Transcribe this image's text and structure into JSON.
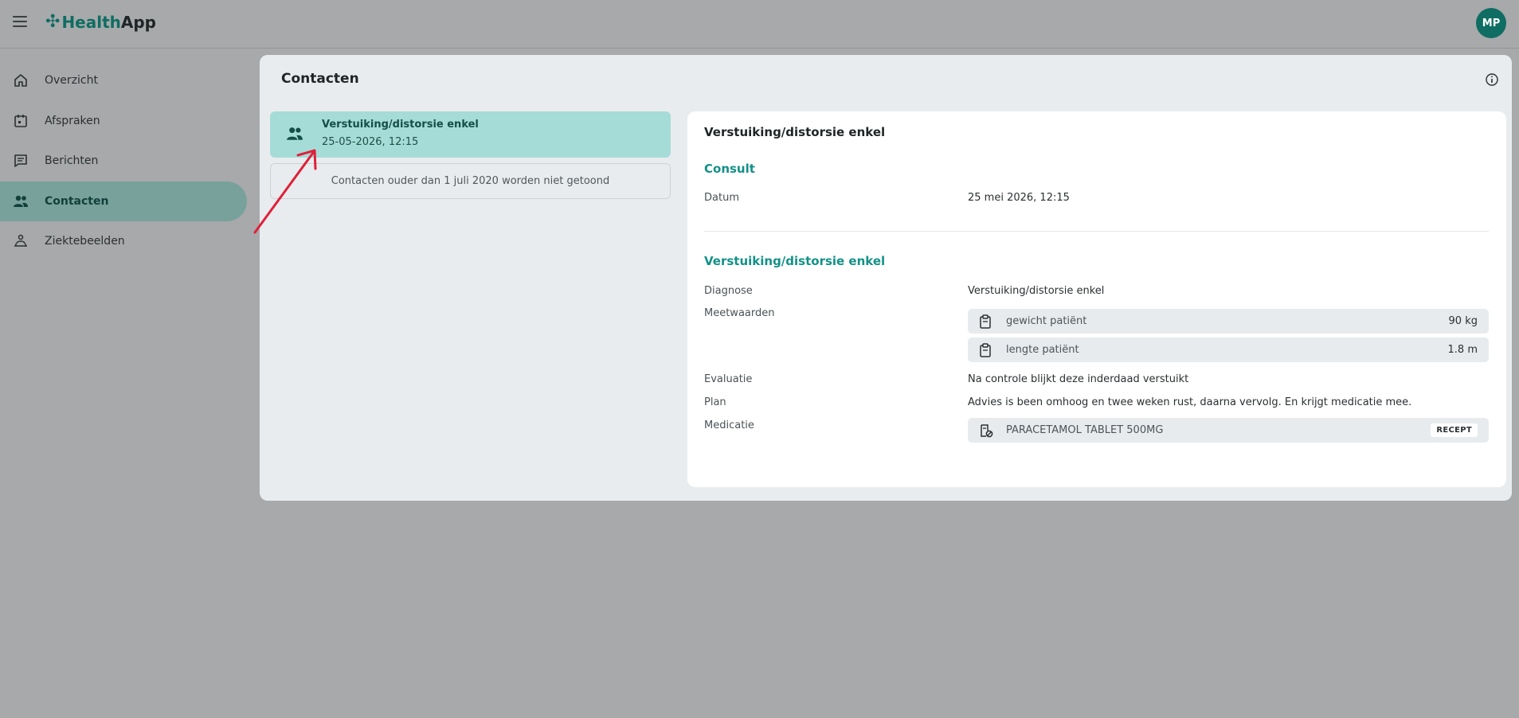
{
  "app": {
    "logo_part1": "Health",
    "logo_part2": "App",
    "user_initials": "MP"
  },
  "sidebar": {
    "items": [
      {
        "label": "Overzicht",
        "icon": "home-icon"
      },
      {
        "label": "Afspraken",
        "icon": "calendar-icon"
      },
      {
        "label": "Berichten",
        "icon": "message-icon"
      },
      {
        "label": "Contacten",
        "icon": "people-icon",
        "active": true
      },
      {
        "label": "Ziektebeelden",
        "icon": "patient-icon"
      }
    ]
  },
  "main": {
    "title": "Contacten",
    "contact": {
      "title": "Verstuiking/distorsie enkel",
      "date": "25-05-2026, 12:15"
    },
    "note": "Contacten ouder dan 1 juli 2020 worden niet getoond"
  },
  "detail": {
    "title": "Verstuiking/distorsie enkel",
    "consult": {
      "heading": "Consult",
      "datum_label": "Datum",
      "datum_value": "25 mei 2026, 12:15"
    },
    "episode": {
      "heading": "Verstuiking/distorsie enkel",
      "diagnose_label": "Diagnose",
      "diagnose_value": "Verstuiking/distorsie enkel",
      "meetwaarden_label": "Meetwaarden",
      "measurements": [
        {
          "label": "gewicht patiënt",
          "value": "90 kg"
        },
        {
          "label": "lengte patiënt",
          "value": "1.8 m"
        }
      ],
      "evaluatie_label": "Evaluatie",
      "evaluatie_value": "Na controle blijkt deze inderdaad verstuikt",
      "plan_label": "Plan",
      "plan_value": "Advies is been omhoog en twee weken rust, daarna vervolg. En krijgt medicatie mee.",
      "medicatie_label": "Medicatie",
      "medication": {
        "name": "PARACETAMOL TABLET 500MG",
        "badge": "RECEPT"
      }
    }
  },
  "colors": {
    "brand": "#0f6d63",
    "accent": "#139187",
    "active_nav": "#78a19c",
    "selected_contact": "#a6dcd7",
    "annotation_arrow": "#e0203a"
  }
}
